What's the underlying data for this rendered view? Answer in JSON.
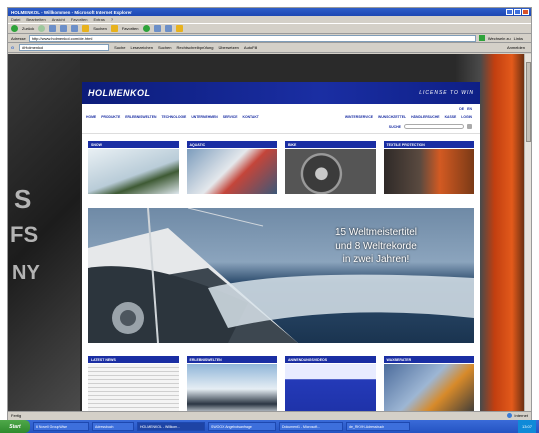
{
  "browser": {
    "title": "HOLMENKOL - Willkommen - Microsoft Internet Explorer",
    "menu": [
      "Datei",
      "Bearbeiten",
      "Ansicht",
      "Favoriten",
      "Extras",
      "?"
    ],
    "toolbar": {
      "back": "Zurück",
      "search": "Suchen",
      "favorites": "Favoriten"
    },
    "address_label": "Adresse",
    "url": "http://www.holmenkol.com/de.html",
    "go_label": "Wechseln zu",
    "links_label": "Links",
    "google_query": "#Holmenkol",
    "google_items": [
      "Suche",
      "Lesezeichen",
      "Suchen",
      "Rechtschreibprüfung",
      "Übersetzen",
      "AutoFill",
      "Anmelden"
    ],
    "status_left": "Fertig",
    "status_zone": "Internet"
  },
  "site": {
    "logo": "HOLMENKOL",
    "slogan": "LICENSE TO WIN",
    "lang": [
      "DE",
      "EN"
    ],
    "nav_left": [
      "HOME",
      "PRODUKTE",
      "ERLEBNISWELTEN",
      "TECHNOLOGIE",
      "UNTERNEHMEN",
      "SERVICE",
      "KONTAKT"
    ],
    "nav_right": [
      "WINTERSERVICE",
      "WUNSCHZETTEL",
      "HÄNDLERSUCHE",
      "KASSE",
      "LOGIN"
    ],
    "search_label": "SUCHE",
    "categories": [
      {
        "label": "SNOW",
        "color": "#cfdde6",
        "color2": "#4a6a3a"
      },
      {
        "label": "AQUATIC",
        "color": "#5b7fa0",
        "color2": "#c94a3a"
      },
      {
        "label": "BIKE",
        "color": "#7a7a7a",
        "color2": "#3b3b3b"
      },
      {
        "label": "TEXTILE PROTECTION",
        "color": "#4a3a30",
        "color2": "#c9501f"
      }
    ],
    "hero_lines": [
      "15 Weltmeistertitel",
      "und 8 Weltrekorde",
      "in zwei Jahren!"
    ],
    "news": [
      {
        "label": "LATEST NEWS",
        "color": "#f2f2f2",
        "color2": "#c8c8c8"
      },
      {
        "label": "ERLEBNISWELTEN",
        "color": "#6e9cc4",
        "color2": "#2c3b4c"
      },
      {
        "label": "ANWENDUNGSVIDEOS",
        "color": "#2b3fc0",
        "color2": "#dfe6ff"
      },
      {
        "label": "WAXBERATER",
        "color": "#5a7aa8",
        "color2": "#d0862c"
      }
    ]
  },
  "taskbar": {
    "start": "Start",
    "tasks": [
      "6 Novell GroupWise",
      "Adressbuch",
      "HOLMENKOL - Willkom...",
      "SWOOX Angebotsanfrage",
      "Dokument1 - Microsoft...",
      "de_RKVH-Adressbuch"
    ],
    "clock": "13:07"
  }
}
